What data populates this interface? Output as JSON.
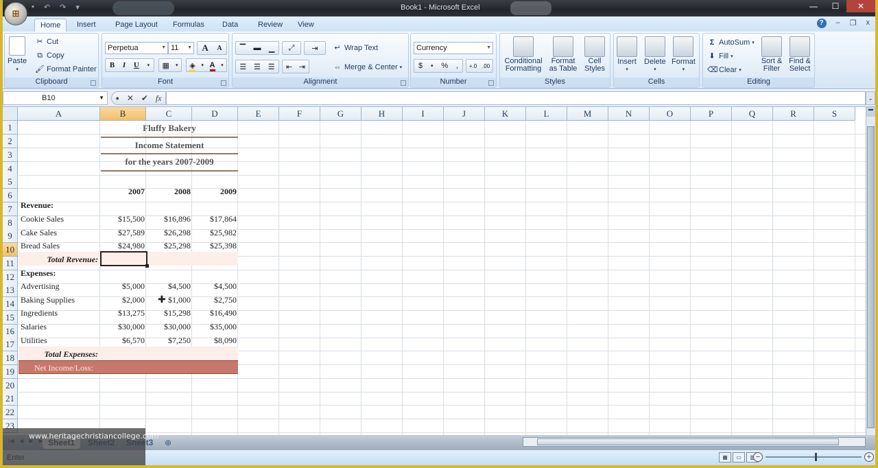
{
  "window": {
    "title": "Book1 - Microsoft Excel",
    "office_button_glyph": "⊞",
    "quick_access": [
      "save-icon",
      "undo-icon",
      "redo-icon",
      "customize-icon"
    ],
    "controls": {
      "minimize": "—",
      "maximize": "☐",
      "close": "✕"
    }
  },
  "ribbon_tabs": [
    "Home",
    "Insert",
    "Page Layout",
    "Formulas",
    "Data",
    "Review",
    "View"
  ],
  "active_tab": "Home",
  "doc_controls": {
    "help": "?",
    "minimize": "–",
    "restore": "❐",
    "close": "x"
  },
  "ribbon": {
    "clipboard": {
      "label": "Clipboard",
      "paste": "Paste",
      "cut": "Cut",
      "copy": "Copy",
      "format_painter": "Format Painter"
    },
    "font": {
      "label": "Font",
      "font_name": "Perpetua",
      "font_size": "11",
      "grow": "A",
      "shrink": "A",
      "bold": "B",
      "italic": "I",
      "underline": "U",
      "fill_color": "#f5d32e",
      "font_color": "#c00000"
    },
    "alignment": {
      "label": "Alignment",
      "wrap_text": "Wrap Text",
      "merge_center": "Merge & Center"
    },
    "number": {
      "label": "Number",
      "format": "Currency",
      "currency": "$",
      "percent": "%",
      "comma": ",",
      "inc_decimal": "+.0",
      "dec_decimal": ".00"
    },
    "styles": {
      "label": "Styles",
      "conditional_formatting": "Conditional Formatting",
      "format_as_table": "Format as Table",
      "cell_styles": "Cell Styles"
    },
    "cells": {
      "label": "Cells",
      "insert": "Insert",
      "delete": "Delete",
      "format": "Format"
    },
    "editing": {
      "label": "Editing",
      "autosum": "AutoSum",
      "fill": "Fill",
      "clear": "Clear",
      "sort_filter": "Sort & Filter",
      "find_select": "Find & Select"
    }
  },
  "formula_bar": {
    "name_box": "B10",
    "formula": "",
    "cancel": "✕",
    "enter": "✔",
    "fx": "fx"
  },
  "columns": [
    "A",
    "B",
    "C",
    "D",
    "E",
    "F",
    "G",
    "H",
    "I",
    "J",
    "K",
    "L",
    "M",
    "N",
    "O",
    "P",
    "Q",
    "R",
    "S"
  ],
  "selected_column": "B",
  "rows": [
    "1",
    "2",
    "3",
    "4",
    "5",
    "6",
    "7",
    "8",
    "9",
    "10",
    "11",
    "12",
    "13",
    "14",
    "15",
    "16",
    "17",
    "18",
    "19",
    "20",
    "21",
    "22",
    "23"
  ],
  "selected_row": "10",
  "sheet": {
    "title1": "Fluffy Bakery",
    "title2": "Income Statement",
    "title3": "for the years 2007-2009",
    "years": [
      "2007",
      "2008",
      "2009"
    ],
    "revenue_label": "Revenue:",
    "revenue": [
      {
        "label": "Cookie Sales",
        "values": [
          "$15,500",
          "$16,896",
          "$17,864"
        ]
      },
      {
        "label": "Cake Sales",
        "values": [
          "$27,589",
          "$26,298",
          "$25,982"
        ]
      },
      {
        "label": "Bread Sales",
        "values": [
          "$24,980",
          "$25,298",
          "$25,398"
        ]
      }
    ],
    "total_revenue_label": "Total Revenue:",
    "expenses_label": "Expenses:",
    "expenses": [
      {
        "label": "Advertising",
        "values": [
          "$5,000",
          "$4,500",
          "$4,500"
        ]
      },
      {
        "label": "Baking Supplies",
        "values": [
          "$2,000",
          "$1,000",
          "$2,750"
        ]
      },
      {
        "label": "Ingredients",
        "values": [
          "$13,275",
          "$15,298",
          "$16,490"
        ]
      },
      {
        "label": "Salaries",
        "values": [
          "$30,000",
          "$30,000",
          "$35,000"
        ]
      },
      {
        "label": "Utilities",
        "values": [
          "$6,570",
          "$7,250",
          "$8,090"
        ]
      }
    ],
    "total_expenses_label": "Total Expenses:",
    "net_income_label": "Net Income/Loss:"
  },
  "sheet_tabs": [
    "Sheet1",
    "Sheet2",
    "Sheet3"
  ],
  "active_sheet": "Sheet1",
  "status": {
    "mode": "Enter"
  },
  "watermark": "www.heritagechristiancollege.com"
}
